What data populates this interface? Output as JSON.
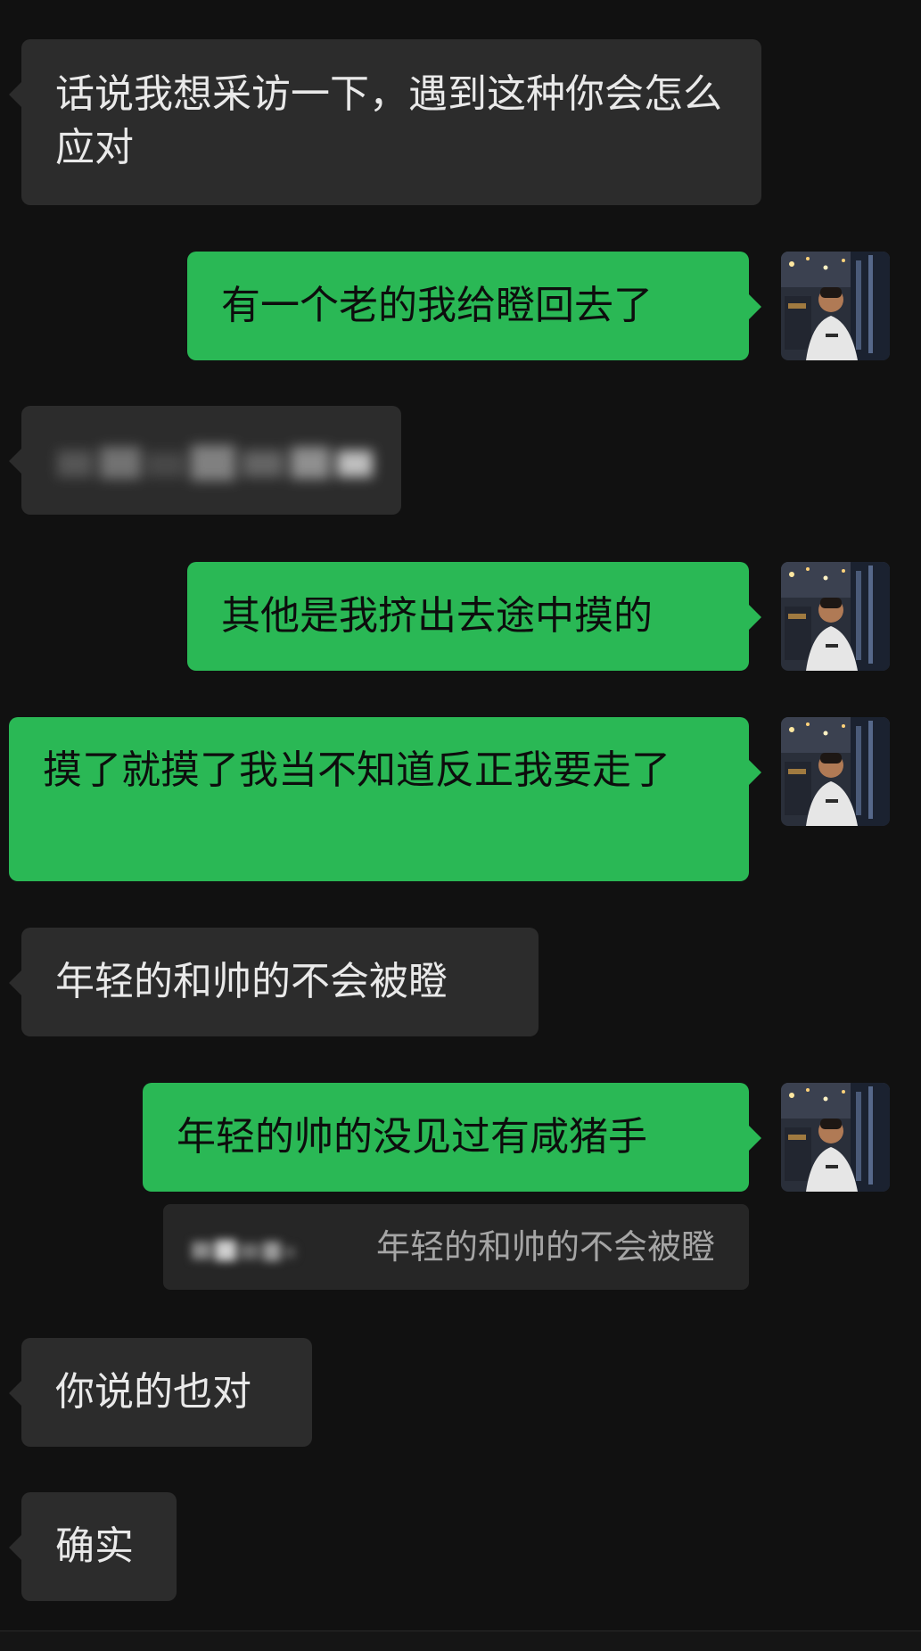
{
  "messages": {
    "m1": "话说我想采访一下，遇到这种你会怎么应对",
    "m2": "有一个老的我给瞪回去了",
    "m4": "其他是我挤出去途中摸的",
    "m5": "摸了就摸了我当不知道反正我要走了",
    "m6": "年轻的和帅的不会被瞪",
    "m7": "年轻的帅的没见过有咸猪手",
    "m7_quote": "年轻的和帅的不会被瞪",
    "m8": "你说的也对",
    "m9": "确实"
  },
  "colors": {
    "background": "#111111",
    "incoming_bubble": "#2c2c2c",
    "outgoing_bubble": "#2ab855",
    "incoming_text": "#e9e9e9",
    "outgoing_text": "#0d0d0d",
    "quote_text": "#a5a5a5"
  },
  "icons": {
    "avatar": "user-avatar-photo"
  }
}
